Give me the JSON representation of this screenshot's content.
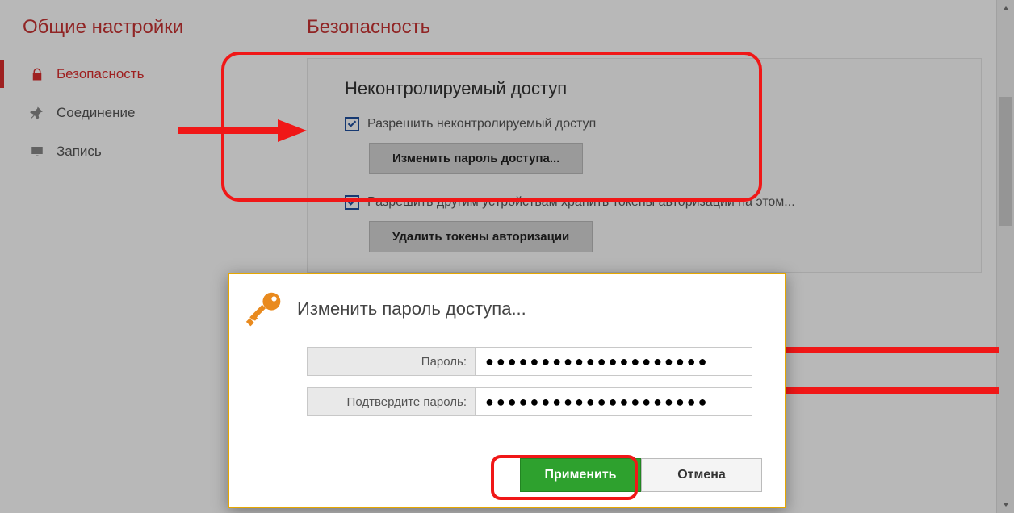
{
  "sidebar": {
    "title": "Общие настройки",
    "items": [
      {
        "label": "Безопасность",
        "icon": "lock-icon",
        "active": true
      },
      {
        "label": "Соединение",
        "icon": "pin-icon",
        "active": false
      },
      {
        "label": "Запись",
        "icon": "monitor-icon",
        "active": false
      }
    ]
  },
  "main": {
    "title": "Безопасность",
    "section": {
      "title": "Неконтролируемый доступ",
      "allow_unsupervised": {
        "label": "Разрешить неконтролируемый доступ",
        "checked": true
      },
      "change_password_btn": "Изменить пароль доступа...",
      "allow_tokens": {
        "label": "Разрешить другим устройствам хранить токены авторизации на этом...",
        "checked": true
      },
      "delete_tokens_btn": "Удалить токены авторизации"
    }
  },
  "dialog": {
    "title": "Изменить пароль доступа...",
    "password_label": "Пароль:",
    "confirm_label": "Подтвердите пароль:",
    "password_masked": "●●●●●●●●●●●●●●●●●●●●",
    "confirm_masked": "●●●●●●●●●●●●●●●●●●●●",
    "apply_btn": "Применить",
    "cancel_btn": "Отмена"
  }
}
